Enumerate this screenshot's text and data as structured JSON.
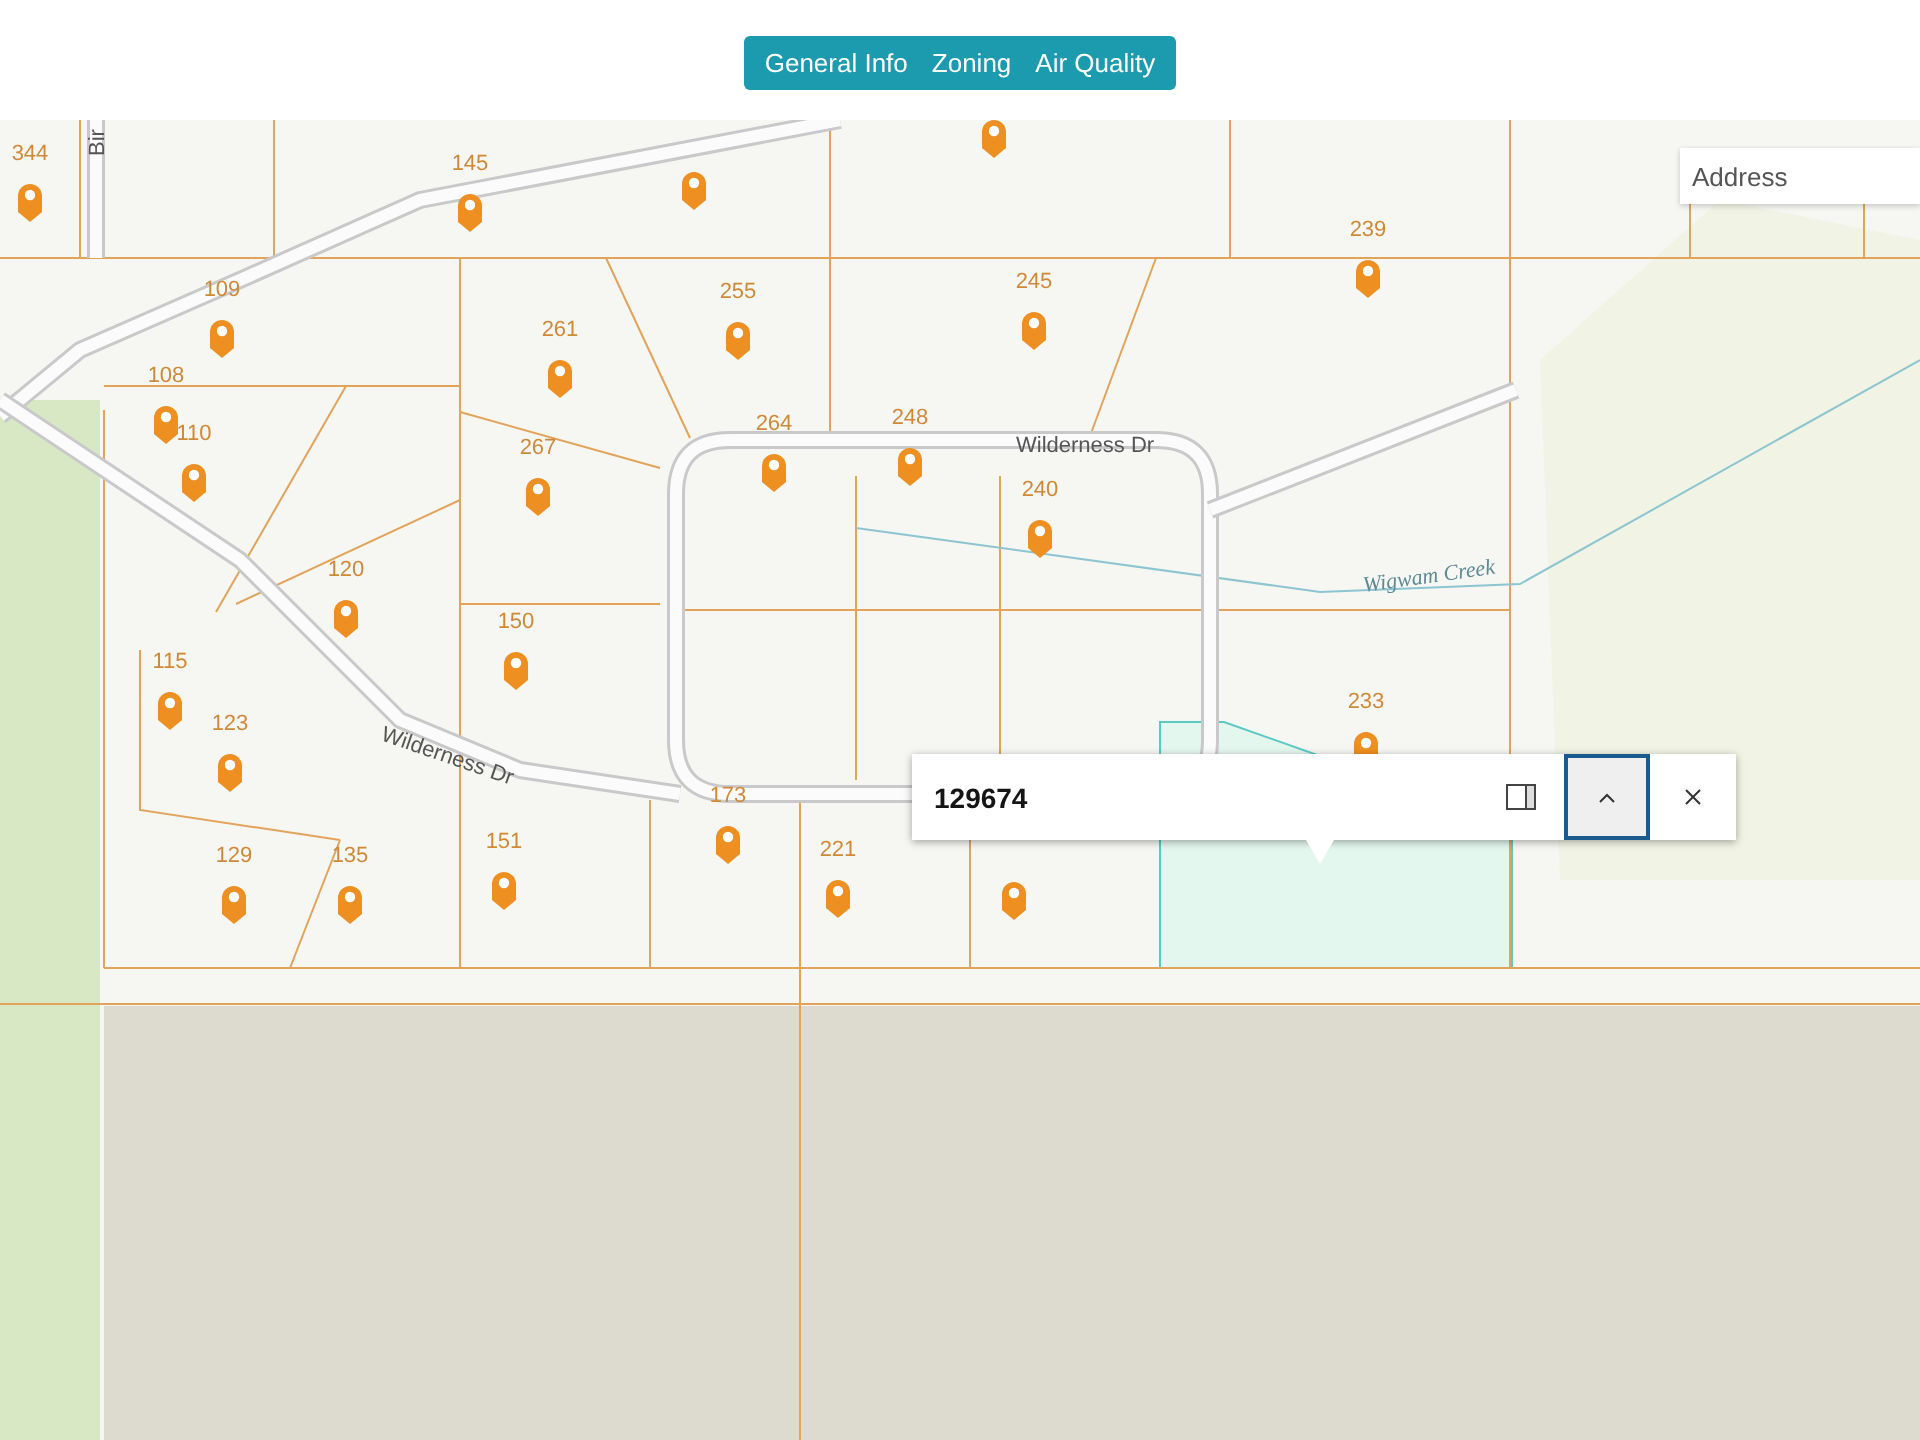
{
  "tabs": [
    {
      "label": "General Info",
      "selected": false
    },
    {
      "label": "Zoning",
      "selected": false
    },
    {
      "label": "Air Quality",
      "selected": false
    }
  ],
  "search": {
    "placeholder": "Address"
  },
  "map": {
    "road_labels": [
      "Bir",
      "Wilderness Dr",
      "Wilderness Dr"
    ],
    "creek_label": "Wigwam Creek",
    "parcel_labels": [
      "344",
      "145",
      "239",
      "109",
      "255",
      "245",
      "261",
      "108",
      "110",
      "264",
      "248",
      "267",
      "240",
      "120",
      "150",
      "115",
      "233",
      "123",
      "173",
      "129",
      "135",
      "151",
      "221"
    ]
  },
  "popup": {
    "title": "129674",
    "collapse_selected": true
  }
}
